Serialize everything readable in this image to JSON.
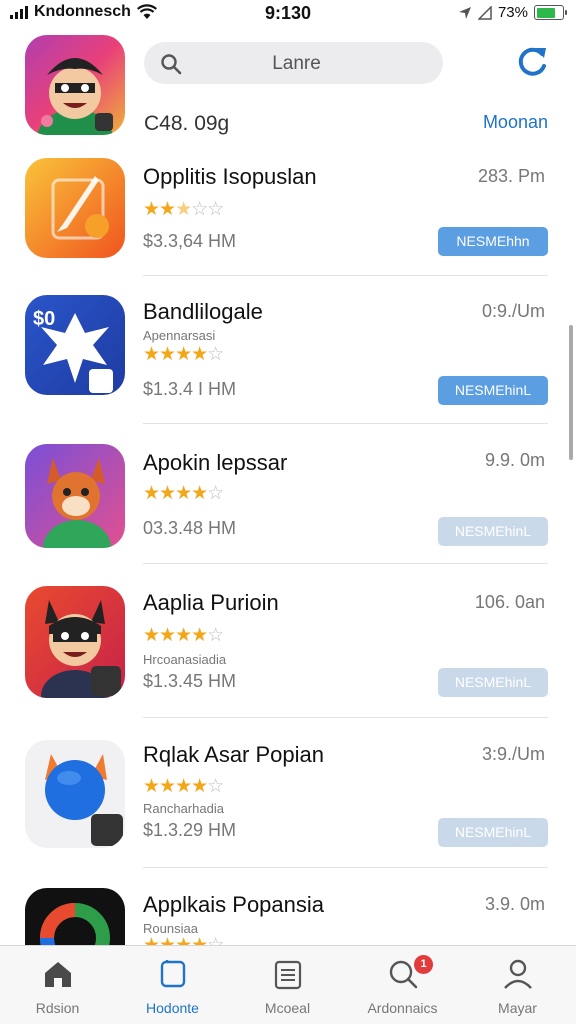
{
  "status_bar": {
    "carrier": "Kndonnesch",
    "time": "9:130",
    "battery_text": "73%",
    "battery_level": 0.73
  },
  "header": {
    "search_text": "Lanre",
    "subtitle_left": "C48. 09g",
    "subtitle_right": "Moonan"
  },
  "apps": [
    {
      "name": "Opplitis Isopuslan",
      "subtitle": "",
      "rating": 2.5,
      "price": "$3.3,64 HM",
      "size": "283. Pm",
      "button": "NESMEhhn",
      "button_color": "#5b9ee2"
    },
    {
      "name": "Bandlilogale",
      "subtitle": "Apennarsasi",
      "rating": 4,
      "price": "$1.3.4 I HM",
      "size": "0:9./Um",
      "button": "NESMEhinL",
      "button_color": "#5b9ee2"
    },
    {
      "name": "Apokin lepssar",
      "subtitle": "",
      "rating": 4,
      "price": "03.3.48 HM",
      "size": "9.9. 0m",
      "button": "NESMEhinL",
      "button_color": "#c9d9ea"
    },
    {
      "name": "Aaplia Purioin",
      "subtitle": "Hrcoanasiadia",
      "rating": 4,
      "price": "$1.3.45 HM",
      "size": "106. 0an",
      "button": "NESMEhinL",
      "button_color": "#c9d9ea"
    },
    {
      "name": "Rqlak Asar Popian",
      "subtitle": "Rancharhadia",
      "rating": 4,
      "price": "$1.3.29 HM",
      "size": "3:9./Um",
      "button": "NESMEhinL",
      "button_color": "#c9d9ea"
    },
    {
      "name": "Applkais Popansia",
      "subtitle": "Rounsiaa",
      "rating": 4,
      "price": "",
      "size": "3.9. 0m",
      "button": "",
      "button_color": "#c9d9ea"
    }
  ],
  "tabs": [
    {
      "label": "Rdsion",
      "icon": "home-icon",
      "active": false
    },
    {
      "label": "Hodonte",
      "icon": "apps-icon",
      "active": true
    },
    {
      "label": "Mcoeal",
      "icon": "document-icon",
      "active": false
    },
    {
      "label": "Ardonnaics",
      "icon": "search-icon",
      "active": false,
      "badge": "1"
    },
    {
      "label": "Mayar",
      "icon": "profile-icon",
      "active": false
    }
  ],
  "colors": {
    "accent": "#1f73c9",
    "button_active": "#5b9ee2",
    "button_muted": "#c9d9ea",
    "star": "#f4a619",
    "badge": "#e23b3b"
  }
}
